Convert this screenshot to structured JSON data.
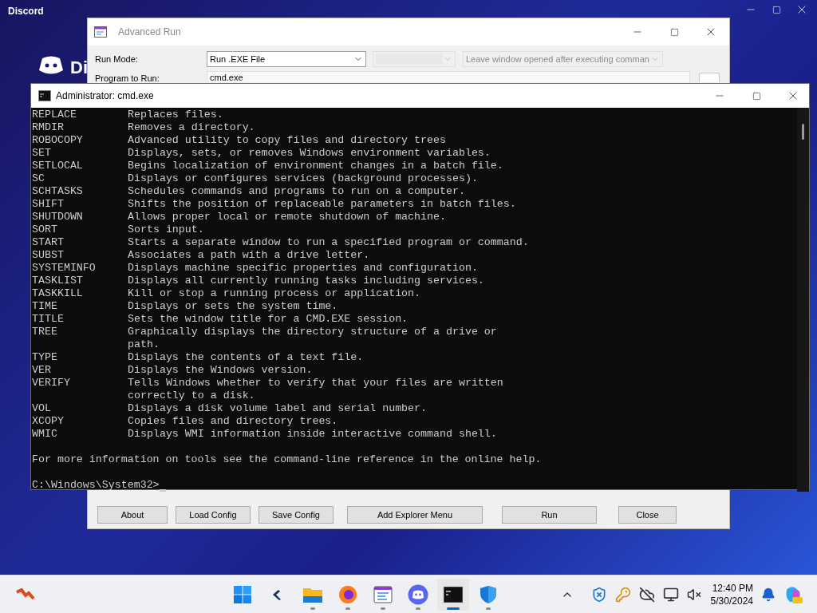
{
  "discord_window": {
    "title": "Discord",
    "logo_text": "Di"
  },
  "advanced_run": {
    "title": "Advanced Run",
    "fields": [
      {
        "label": "Run Mode:",
        "dropdowns": [
          {
            "value": "Run .EXE File",
            "disabled": false
          },
          {
            "disabled": true
          },
          {
            "value": "Leave window opened after executing comman",
            "disabled": true
          }
        ]
      },
      {
        "label": "Program to Run:",
        "value": "cmd.exe"
      }
    ],
    "buttons": [
      "About",
      "Load Config",
      "Save Config",
      "Add Explorer Menu",
      "Run",
      "Close"
    ]
  },
  "cmd_window": {
    "title": "Administrator: cmd.exe",
    "lines": [
      {
        "kind": "entry",
        "command": "REPLACE",
        "description": "Replaces files."
      },
      {
        "kind": "entry",
        "command": "RMDIR",
        "description": "Removes a directory."
      },
      {
        "kind": "entry",
        "command": "ROBOCOPY",
        "description": "Advanced utility to copy files and directory trees"
      },
      {
        "kind": "entry",
        "command": "SET",
        "description": "Displays, sets, or removes Windows environment variables."
      },
      {
        "kind": "entry",
        "command": "SETLOCAL",
        "description": "Begins localization of environment changes in a batch file."
      },
      {
        "kind": "entry",
        "command": "SC",
        "description": "Displays or configures services (background processes)."
      },
      {
        "kind": "entry",
        "command": "SCHTASKS",
        "description": "Schedules commands and programs to run on a computer."
      },
      {
        "kind": "entry",
        "command": "SHIFT",
        "description": "Shifts the position of replaceable parameters in batch files."
      },
      {
        "kind": "entry",
        "command": "SHUTDOWN",
        "description": "Allows proper local or remote shutdown of machine."
      },
      {
        "kind": "entry",
        "command": "SORT",
        "description": "Sorts input."
      },
      {
        "kind": "entry",
        "command": "START",
        "description": "Starts a separate window to run a specified program or command."
      },
      {
        "kind": "entry",
        "command": "SUBST",
        "description": "Associates a path with a drive letter."
      },
      {
        "kind": "entry",
        "command": "SYSTEMINFO",
        "description": "Displays machine specific properties and configuration."
      },
      {
        "kind": "entry",
        "command": "TASKLIST",
        "description": "Displays all currently running tasks including services."
      },
      {
        "kind": "entry",
        "command": "TASKKILL",
        "description": "Kill or stop a running process or application."
      },
      {
        "kind": "entry",
        "command": "TIME",
        "description": "Displays or sets the system time."
      },
      {
        "kind": "entry",
        "command": "TITLE",
        "description": "Sets the window title for a CMD.EXE session."
      },
      {
        "kind": "entry",
        "command": "TREE",
        "description": "Graphically displays the directory structure of a drive or"
      },
      {
        "kind": "continuation",
        "description": "path."
      },
      {
        "kind": "entry",
        "command": "TYPE",
        "description": "Displays the contents of a text file."
      },
      {
        "kind": "entry",
        "command": "VER",
        "description": "Displays the Windows version."
      },
      {
        "kind": "entry",
        "command": "VERIFY",
        "description": "Tells Windows whether to verify that your files are written"
      },
      {
        "kind": "continuation",
        "description": "correctly to a disk."
      },
      {
        "kind": "entry",
        "command": "VOL",
        "description": "Displays a disk volume label and serial number."
      },
      {
        "kind": "entry",
        "command": "XCOPY",
        "description": "Copies files and directory trees."
      },
      {
        "kind": "entry",
        "command": "WMIC",
        "description": "Displays WMI information inside interactive command shell."
      },
      {
        "kind": "blank"
      },
      {
        "kind": "text",
        "text": "For more information on tools see the command-line reference in the online help."
      },
      {
        "kind": "blank"
      },
      {
        "kind": "prompt",
        "text": "C:\\Windows\\System32>"
      }
    ]
  },
  "taskbar": {
    "apps": [
      {
        "kind": "start",
        "running": false,
        "selected": false
      },
      {
        "kind": "widget",
        "running": false,
        "selected": false
      },
      {
        "kind": "explorer",
        "running": true,
        "selected": false
      },
      {
        "kind": "firefox",
        "running": true,
        "selected": false
      },
      {
        "kind": "app",
        "running": true,
        "selected": false
      },
      {
        "kind": "discord",
        "running": true,
        "selected": false
      },
      {
        "kind": "terminal",
        "running": true,
        "selected": true
      },
      {
        "kind": "defender",
        "running": true,
        "selected": false
      }
    ],
    "clock": {
      "time": "12:40 PM",
      "date": "5/30/2024"
    }
  }
}
